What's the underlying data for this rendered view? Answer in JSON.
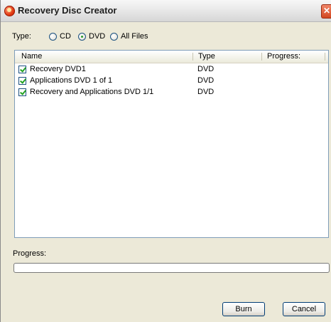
{
  "window": {
    "title": "Recovery Disc Creator",
    "icon": "recovery-icon",
    "close_glyph": "✕"
  },
  "type_selector": {
    "label": "Type:",
    "options": [
      {
        "label": "CD",
        "selected": false
      },
      {
        "label": "DVD",
        "selected": true
      },
      {
        "label": "All Files",
        "selected": false
      }
    ]
  },
  "list": {
    "columns": [
      "Name",
      "Type",
      "Progress:"
    ],
    "rows": [
      {
        "checked": true,
        "name": "Recovery DVD1",
        "type": "DVD",
        "progress": ""
      },
      {
        "checked": true,
        "name": "Applications DVD 1 of 1",
        "type": "DVD",
        "progress": ""
      },
      {
        "checked": true,
        "name": "Recovery and Applications DVD 1/1",
        "type": "DVD",
        "progress": ""
      }
    ]
  },
  "progress": {
    "label": "Progress:",
    "value": 0
  },
  "buttons": {
    "burn": "Burn",
    "cancel": "Cancel"
  },
  "colors": {
    "accent": "#2a9a2a",
    "border": "#7f9db9",
    "background": "#ece9d8"
  }
}
